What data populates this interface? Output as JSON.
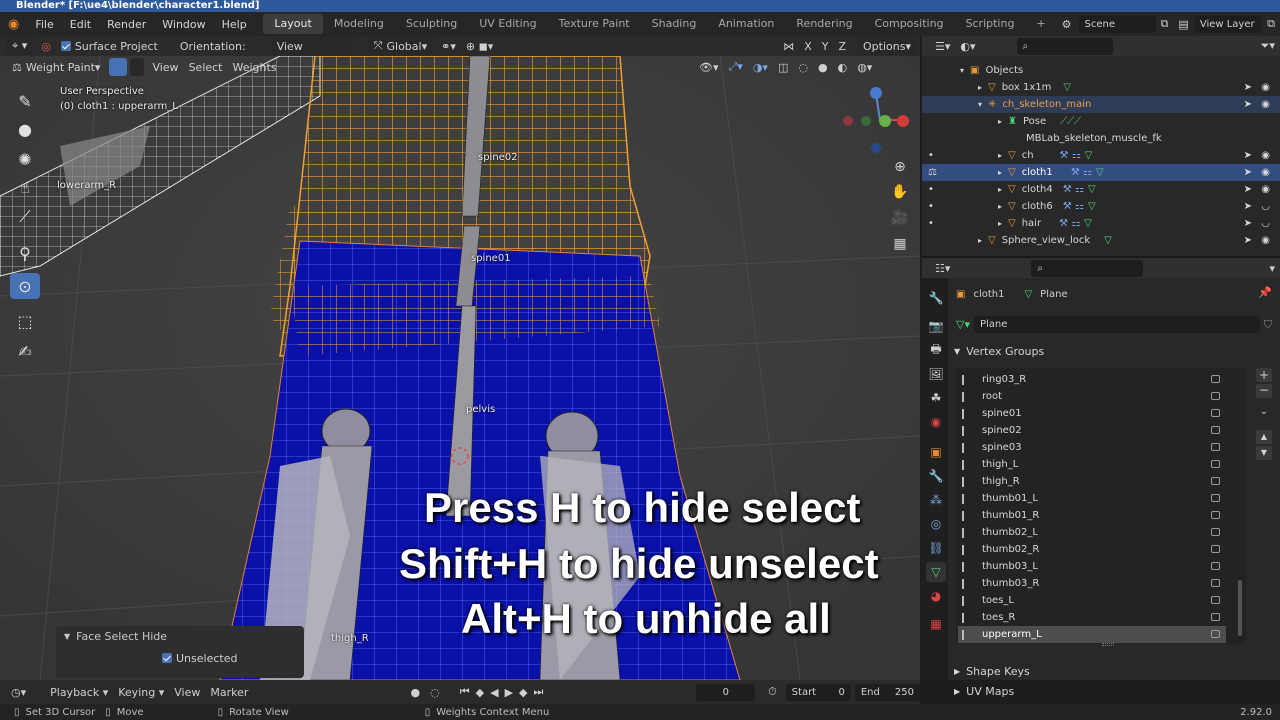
{
  "window": {
    "title": "Blender* [F:\\ue4\\blender\\character1.blend]"
  },
  "menu": {
    "file": "File",
    "edit": "Edit",
    "render": "Render",
    "window": "Window",
    "help": "Help"
  },
  "workspaces": [
    "Layout",
    "Modeling",
    "Sculpting",
    "UV Editing",
    "Texture Paint",
    "Shading",
    "Animation",
    "Rendering",
    "Compositing",
    "Scripting"
  ],
  "workspace_add": "+",
  "scene": {
    "label": "Scene",
    "view_layer": "View Layer"
  },
  "tool_header": {
    "surface_project": "Surface Project",
    "orientation_label": "Orientation:",
    "orientation_value": "View",
    "transform": "Global",
    "axis_x": "X",
    "axis_y": "Y",
    "axis_z": "Z",
    "options": "Options"
  },
  "viewport_header": {
    "mode": "Weight Paint",
    "view": "View",
    "select": "Select",
    "weights": "Weights"
  },
  "viewport": {
    "perspective": "User Perspective",
    "object_info": "(0) cloth1 : upperarm_L",
    "bone_labels": [
      "spine02",
      "spine01",
      "pelvis",
      "thigh_R",
      "lowerarm_R"
    ]
  },
  "overlay_text": [
    "Press H to hide select",
    "Shift+H to hide unselect",
    "Alt+H to unhide all"
  ],
  "operator_panel": {
    "title": "Face Select Hide",
    "unselected": "Unselected"
  },
  "outliner": {
    "items": [
      {
        "name": "Objects",
        "indent": 0,
        "selected": false
      },
      {
        "name": "box 1x1m",
        "indent": 1,
        "selected": false
      },
      {
        "name": "ch_skeleton_main",
        "indent": 1,
        "selected": false,
        "highlight": true
      },
      {
        "name": "Pose",
        "indent": 2,
        "selected": false
      },
      {
        "name": "MBLab_skeleton_muscle_fk",
        "indent": 2,
        "selected": false
      },
      {
        "name": "ch",
        "indent": 2,
        "selected": false
      },
      {
        "name": "cloth1",
        "indent": 2,
        "selected": true
      },
      {
        "name": "cloth4",
        "indent": 2,
        "selected": false
      },
      {
        "name": "cloth6",
        "indent": 2,
        "selected": false
      },
      {
        "name": "hair",
        "indent": 2,
        "selected": false
      },
      {
        "name": "Sphere_view_lock",
        "indent": 1,
        "selected": false
      }
    ]
  },
  "properties": {
    "object": "cloth1",
    "data": "Plane",
    "mesh_name": "Plane",
    "vertex_groups_title": "Vertex Groups",
    "vertex_groups": [
      "ring03_R",
      "root",
      "spine01",
      "spine02",
      "spine03",
      "thigh_L",
      "thigh_R",
      "thumb01_L",
      "thumb01_R",
      "thumb02_L",
      "thumb02_R",
      "thumb03_L",
      "thumb03_R",
      "toes_L",
      "toes_R",
      "upperarm_L"
    ],
    "active_group": "upperarm_L",
    "shape_keys": "Shape Keys",
    "uv_maps": "UV Maps"
  },
  "timeline": {
    "playback": "Playback",
    "keying": "Keying",
    "view": "View",
    "marker": "Marker",
    "current_frame": "0",
    "start_label": "Start",
    "start": "0",
    "end_label": "End",
    "end": "250"
  },
  "status": {
    "cursor": "Set 3D Cursor",
    "move": "Move",
    "rotate": "Rotate View",
    "context": "Weights Context Menu",
    "version": "2.92.0"
  },
  "colors": {
    "accent": "#4772b3",
    "wire": "#f0a030",
    "mesh_blue": "#0a10a8",
    "selection": "#334d80"
  }
}
